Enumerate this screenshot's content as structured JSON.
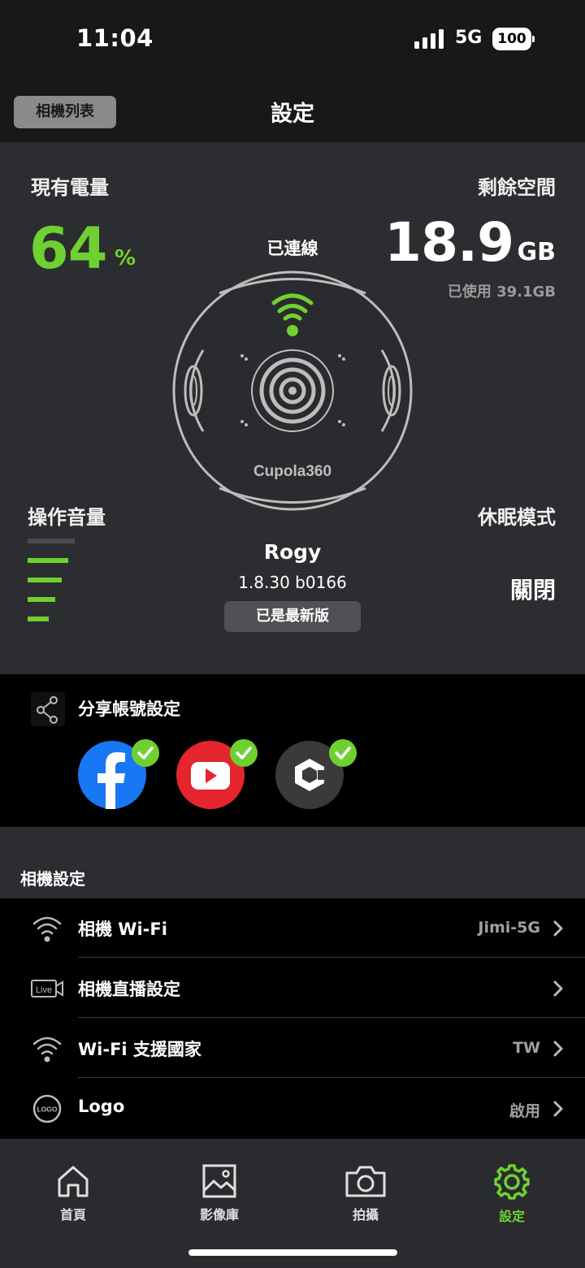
{
  "status_bar": {
    "time": "11:04",
    "network": "5G",
    "battery": "100"
  },
  "header": {
    "camera_list_label": "相機列表",
    "title": "設定"
  },
  "dashboard": {
    "battery_label": "現有電量",
    "battery_value": "64",
    "battery_unit": "%",
    "storage_label": "剩餘空間",
    "storage_value": "18.9",
    "storage_unit": "GB",
    "storage_used": "已使用 39.1GB",
    "connection_status": "已連線",
    "camera_brand": "Cupola360",
    "volume_label": "操作音量",
    "volume_level": 4,
    "volume_max": 5,
    "device_name": "Rogy",
    "firmware_version": "1.8.30 b0166",
    "update_status": "已是最新版",
    "sleep_label": "休眠模式",
    "sleep_value": "關閉"
  },
  "share": {
    "title": "分享帳號設定",
    "accounts": [
      {
        "name": "facebook-icon",
        "connected": true
      },
      {
        "name": "youtube-icon",
        "connected": true
      },
      {
        "name": "cupola-icon",
        "connected": true
      }
    ]
  },
  "camera_settings": {
    "title": "相機設定",
    "items": [
      {
        "icon": "wifi-icon",
        "label": "相機 Wi-Fi",
        "value": "Jimi-5G"
      },
      {
        "icon": "live-icon",
        "label": "相機直播設定",
        "value": ""
      },
      {
        "icon": "wifi-icon",
        "label": "Wi-Fi 支援國家",
        "value": "TW"
      },
      {
        "icon": "logo-icon",
        "label": "Logo",
        "value": "啟用"
      }
    ]
  },
  "tabbar": {
    "items": [
      {
        "label": "首頁",
        "icon": "home-icon"
      },
      {
        "label": "影像庫",
        "icon": "gallery-icon"
      },
      {
        "label": "拍攝",
        "icon": "camera-icon"
      },
      {
        "label": "設定",
        "icon": "gear-icon",
        "active": true
      }
    ]
  },
  "colors": {
    "accent": "#6fd12f",
    "panel": "#2c2d30"
  }
}
